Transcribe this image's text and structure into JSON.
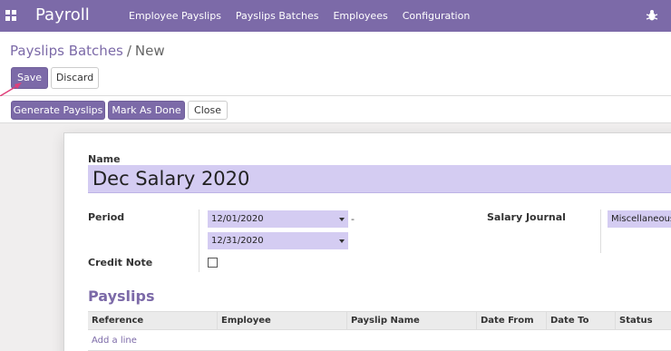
{
  "app": {
    "name": "Payroll"
  },
  "menu": [
    "Employee Payslips",
    "Payslips Batches",
    "Employees",
    "Configuration"
  ],
  "breadcrumb": {
    "parent": "Payslips Batches",
    "separator": "/",
    "current": "New"
  },
  "buttons": {
    "save": "Save",
    "discard": "Discard"
  },
  "status_buttons": {
    "generate": "Generate Payslips",
    "done": "Mark As Done",
    "close": "Close"
  },
  "form": {
    "name_label": "Name",
    "name_value": "Dec Salary 2020",
    "period_label": "Period",
    "period_start": "12/01/2020",
    "period_separator": "-",
    "period_end": "12/31/2020",
    "journal_label": "Salary Journal",
    "journal_value": "Miscellaneous",
    "credit_note_label": "Credit Note",
    "credit_note_checked": false
  },
  "payslips": {
    "title": "Payslips",
    "columns": [
      "Reference",
      "Employee",
      "Payslip Name",
      "Date From",
      "Date To",
      "Status"
    ],
    "add_line": "Add a line"
  },
  "colors": {
    "brand": "#7c6aa8",
    "field_bg": "#d4ccf2",
    "arrow": "#e0407a"
  },
  "icons": {
    "apps": "apps-grid-icon",
    "debug": "bug-icon",
    "dropdown": "caret-down-icon"
  }
}
